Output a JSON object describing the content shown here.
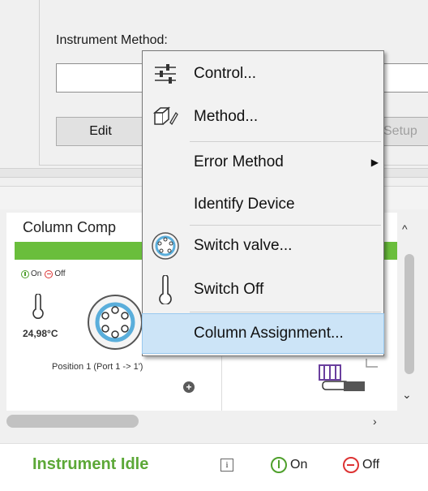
{
  "instrument_method": {
    "label": "Instrument Method:",
    "value": "",
    "edit_label": "Edit",
    "setup_label": "Setup"
  },
  "context_menu": {
    "items": [
      {
        "label": "Control...",
        "icon": "sliders-icon"
      },
      {
        "label": "Method...",
        "icon": "method-icon"
      },
      {
        "label": "Error Method",
        "icon": "",
        "submenu": true
      },
      {
        "label": "Identify Device",
        "icon": ""
      },
      {
        "label": "Switch valve...",
        "icon": "valve-icon"
      },
      {
        "label": "Switch Off",
        "icon": "thermometer-icon"
      },
      {
        "label": "Column Assignment...",
        "icon": "",
        "highlighted": true
      }
    ]
  },
  "column_compartment": {
    "title": "Column Comp",
    "on_label": "On",
    "off_label": "Off",
    "temperature": "24,98°C",
    "position": "Position 1 (Port 1 -> 1')",
    "status_color": "#6abe3c"
  },
  "status_footer": {
    "status": "Instrument Idle",
    "info_label": "i",
    "on_label": "On",
    "off_label": "Off",
    "status_color": "#5ca837"
  }
}
